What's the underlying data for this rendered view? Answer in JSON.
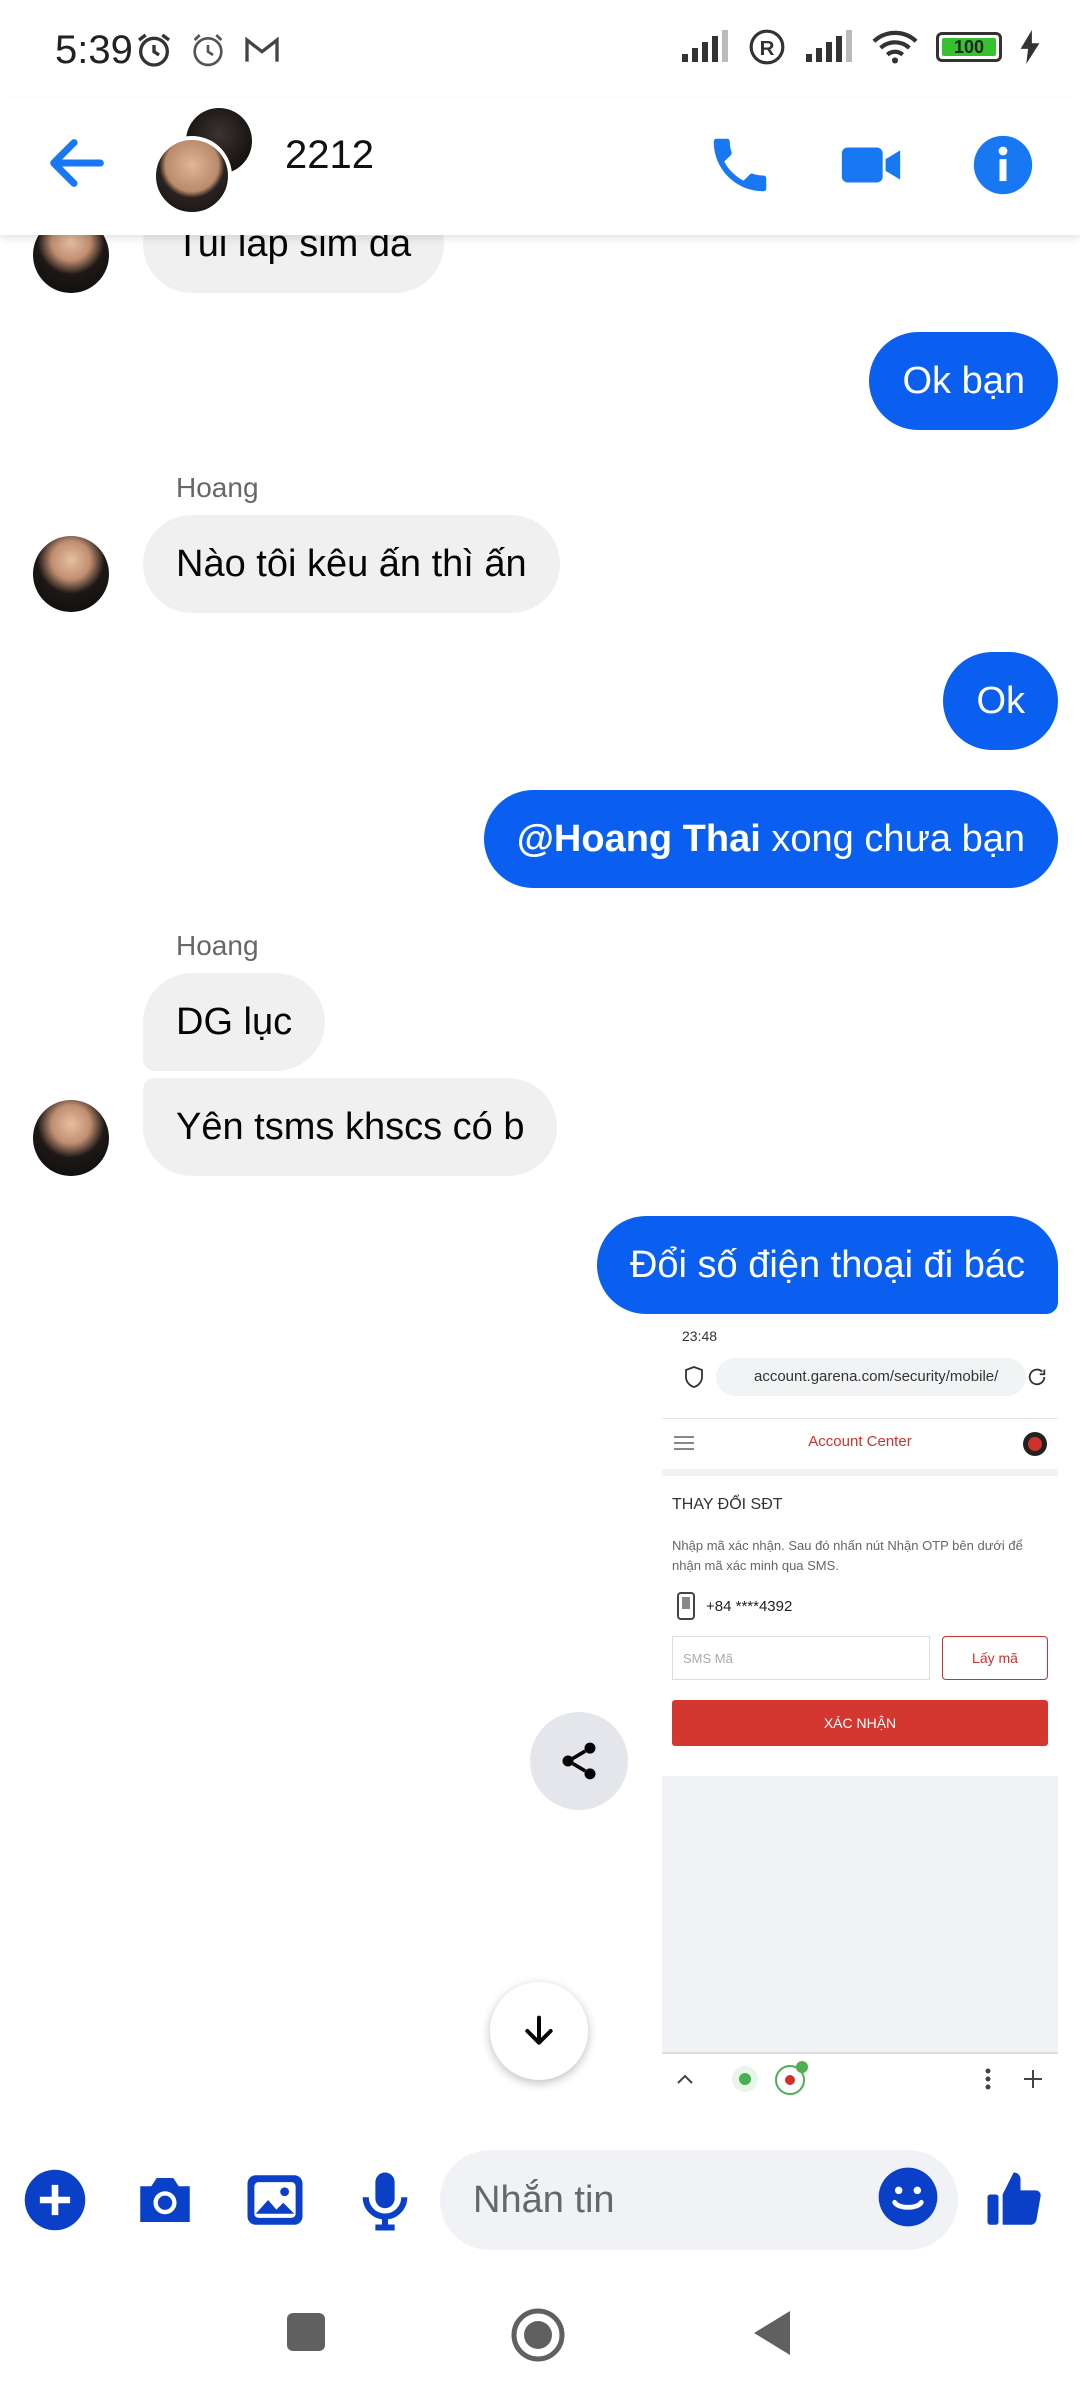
{
  "status_bar": {
    "time": "5:39",
    "battery": "100"
  },
  "header": {
    "title": "2212"
  },
  "messages": {
    "m1": "Tui lấp sim đã",
    "m2": "Ok bạn",
    "sender1": "Hoang",
    "m3": "Nào tôi kêu ấn thì ấn",
    "m4": "Ok",
    "m5_mention": "@Hoang Thai",
    "m5_text": " xong chưa bạn",
    "sender2": "Hoang",
    "m6": "DG lục",
    "m7": "Yên tsms khscs có b",
    "m8": "Đổi số điện thoại đi bác"
  },
  "screenshot": {
    "status_time": "23:48",
    "url": "account.garena.com/security/mobile/",
    "brand": "Account Center",
    "heading": "THAY ĐỔI SĐT",
    "paragraph": "Nhập mã xác nhận. Sau đó nhấn nút Nhận OTP bên dưới để nhận mã xác minh qua SMS.",
    "phone": "+84 ****4392",
    "sms_placeholder": "SMS Mã",
    "get_code": "Lấy mã",
    "confirm": "XÁC NHẬN"
  },
  "composer": {
    "placeholder": "Nhắn tin"
  },
  "colors": {
    "accent": "#0a5ff0",
    "icon_blue": "#1877f2",
    "composer_blue": "#0a40c8",
    "bubble_in": "#f0f0f0"
  }
}
